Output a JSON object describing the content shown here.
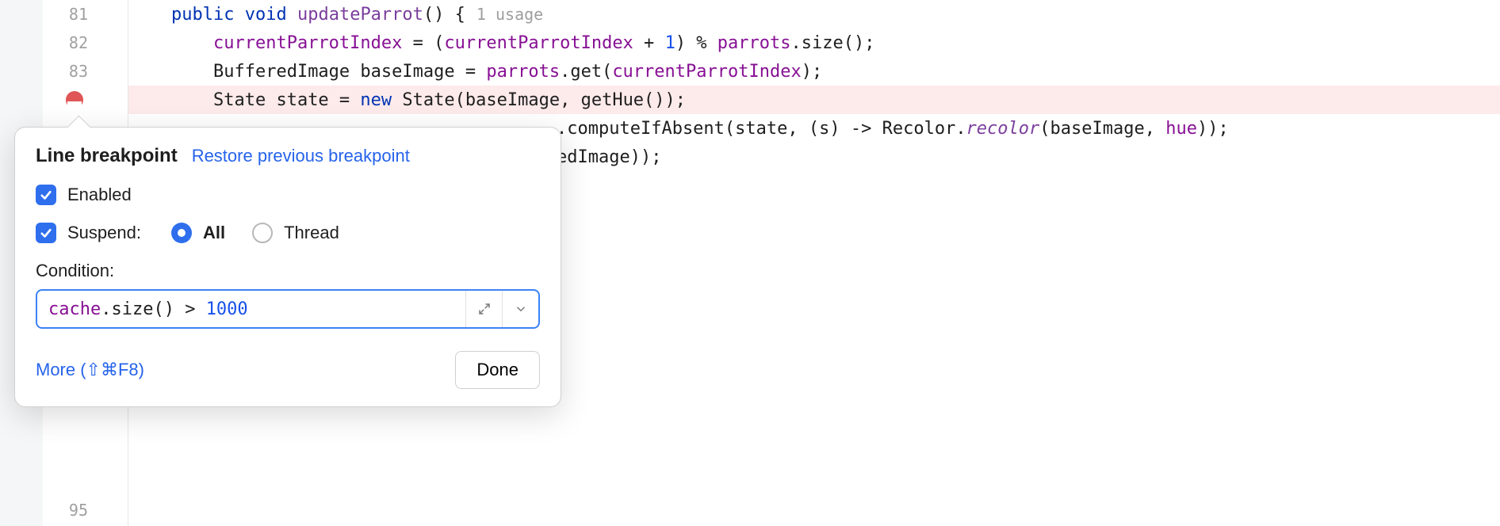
{
  "editor": {
    "lines": [
      {
        "num": "81"
      },
      {
        "num": "82"
      },
      {
        "num": "83"
      },
      {
        "num": ""
      },
      {
        "num": ""
      },
      {
        "num": ""
      }
    ],
    "bottom_line_num": "95",
    "code": {
      "l81_kw1": "public",
      "l81_kw2": "void",
      "l81_name": "updateParrot",
      "l81_paren": "() {",
      "l81_hint": "1 usage",
      "l82_a": "currentParrotIndex",
      "l82_eq": " = (",
      "l82_b": "currentParrotIndex",
      "l82_plus": " + ",
      "l82_num": "1",
      "l82_c": ") % ",
      "l82_d": "parrots",
      "l82_e": ".size();",
      "l83_a": "BufferedImage baseImage = ",
      "l83_b": "parrots",
      "l83_c": ".get(",
      "l83_d": "currentParrotIndex",
      "l83_e": ");",
      "l84_a": "State state = ",
      "l84_kw": "new",
      "l84_b": " State(baseImage, getHue());",
      "l85_a": ".computeIfAbsent(state, (s) -> Recolor.",
      "l85_b": "recolor",
      "l85_c": "(baseImage, ",
      "l85_d": "hue",
      "l85_e": "));",
      "l86_a": "edImage));"
    }
  },
  "popup": {
    "title": "Line breakpoint",
    "restore": "Restore previous breakpoint",
    "enabled_label": "Enabled",
    "suspend_label": "Suspend:",
    "radio_all": "All",
    "radio_thread": "Thread",
    "condition_label": "Condition:",
    "condition_field": "cache",
    "condition_tail": ".size() > ",
    "condition_num": "1000",
    "more": "More (⇧⌘F8)",
    "done": "Done"
  }
}
